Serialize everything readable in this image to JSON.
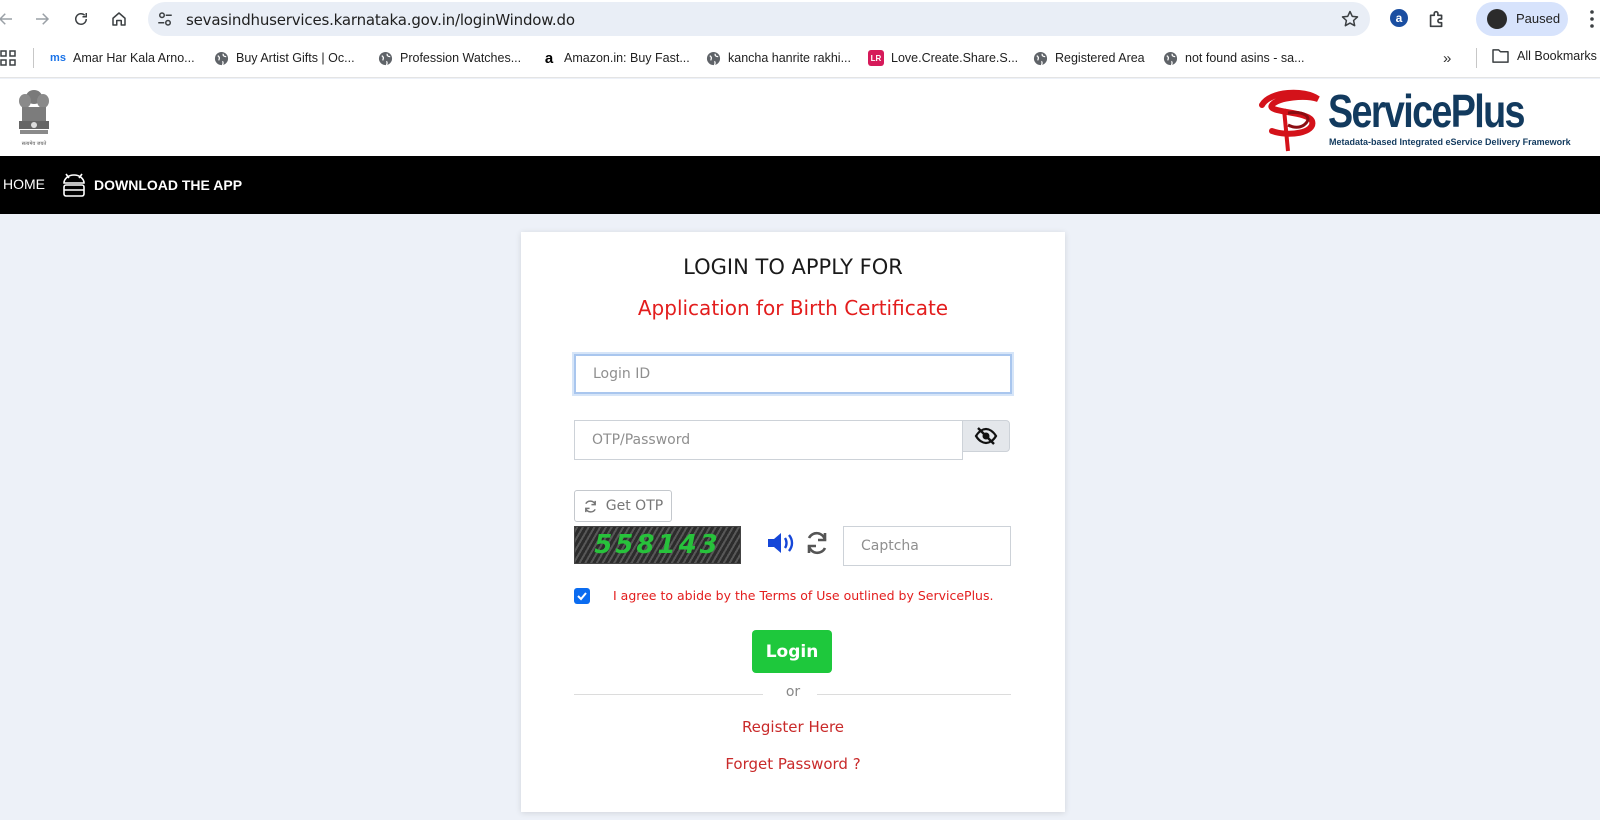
{
  "browser": {
    "url": "sevasindhuservices.karnataka.gov.in/loginWindow.do",
    "profile_label": "Paused",
    "extension_label": "a",
    "bookmarks": [
      {
        "label": "Amar Har Kala Arno...",
        "fav_text": "ms",
        "fav_color": "#1a73e8"
      },
      {
        "label": "Buy Artist Gifts | Oc...",
        "fav_text": "",
        "fav_color": "#5f6368"
      },
      {
        "label": "Profession Watches...",
        "fav_text": "",
        "fav_color": "#5f6368"
      },
      {
        "label": "Amazon.in: Buy Fast...",
        "fav_text": "a",
        "fav_color": "#000000"
      },
      {
        "label": "kancha hanrite rakhi...",
        "fav_text": "",
        "fav_color": "#5f6368"
      },
      {
        "label": "Love.Create.Share.S...",
        "fav_text": "LR",
        "fav_color": "#d61a5a"
      },
      {
        "label": "Registered Area",
        "fav_text": "",
        "fav_color": "#5f6368"
      },
      {
        "label": "not found asins - sa...",
        "fav_text": "",
        "fav_color": "#5f6368"
      }
    ],
    "more_label": "»",
    "all_bookmarks_label": "All Bookmarks"
  },
  "site": {
    "brand_title": "ServicePlus",
    "brand_subtitle": "Metadata-based Integrated eService Delivery Framework",
    "emblem_caption": "सत्यमेव जयते",
    "nav": {
      "home": "HOME",
      "download": "DOWNLOAD THE APP"
    }
  },
  "login": {
    "heading": "LOGIN TO APPLY FOR",
    "service": "Application for Birth Certificate",
    "login_id_placeholder": "Login ID",
    "password_placeholder": "OTP/Password",
    "get_otp_label": "Get OTP",
    "captcha_code": "558143",
    "captcha_placeholder": "Captcha",
    "agree_text": "I agree to abide by the Terms of Use outlined by ServicePlus.",
    "agree_checked": true,
    "login_button": "Login",
    "or_text": "or",
    "register_link": "Register Here",
    "forgot_link": "Forget Password ?"
  },
  "colors": {
    "accent_red": "#e31d1d",
    "login_green": "#1ec83c",
    "brand_navy": "#123a5e",
    "checkbox_blue": "#0b6cf0"
  }
}
